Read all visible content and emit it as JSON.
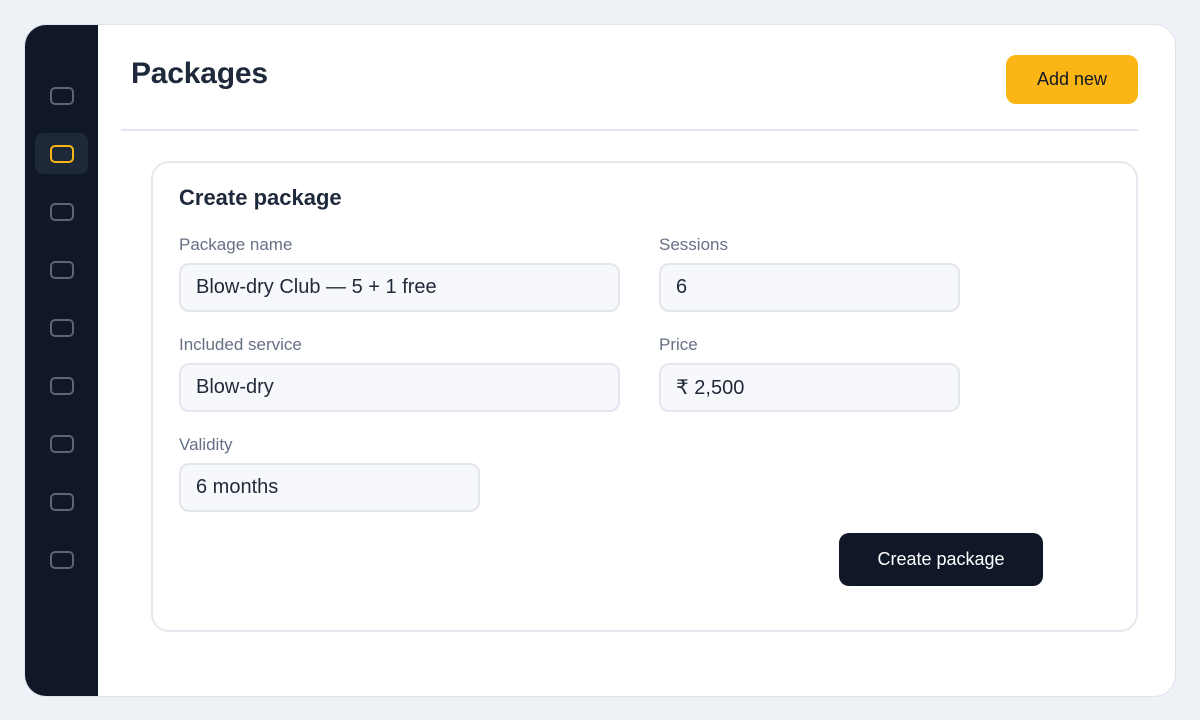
{
  "sidebar": {
    "items": [
      {
        "icon": "nav-icon",
        "active": false
      },
      {
        "icon": "packages-icon",
        "active": true
      },
      {
        "icon": "nav-icon",
        "active": false
      },
      {
        "icon": "nav-icon",
        "active": false
      },
      {
        "icon": "nav-icon",
        "active": false
      },
      {
        "icon": "nav-icon",
        "active": false
      },
      {
        "icon": "nav-icon",
        "active": false
      },
      {
        "icon": "nav-icon",
        "active": false
      },
      {
        "icon": "nav-icon",
        "active": false
      }
    ]
  },
  "header": {
    "title": "Packages",
    "add_button_label": "Add new"
  },
  "form": {
    "title": "Create package",
    "package_name": {
      "label": "Package name",
      "value": "Blow-dry Club — 5 + 1 free"
    },
    "sessions": {
      "label": "Sessions",
      "value": "6"
    },
    "included_service": {
      "label": "Included service",
      "value": "Blow-dry"
    },
    "price": {
      "label": "Price",
      "value": "₹ 2,500"
    },
    "validity": {
      "label": "Validity",
      "value": "6 months"
    },
    "submit_label": "Create package"
  },
  "colors": {
    "accent": "#fbb515",
    "sidebar_bg": "#101828",
    "page_bg": "#eef1f6",
    "primary_button": "#101828"
  }
}
